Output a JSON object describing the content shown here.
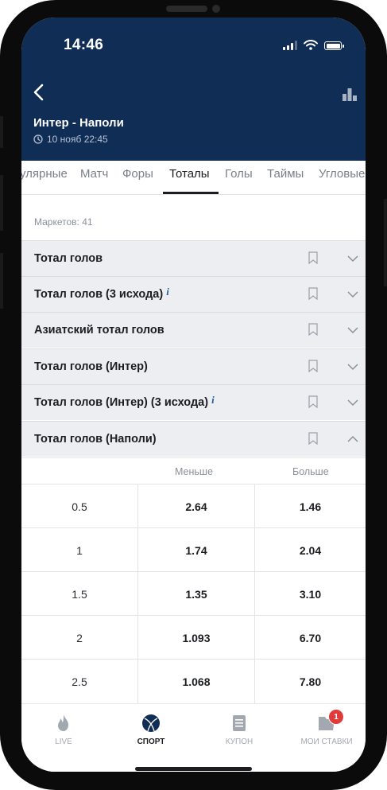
{
  "status_bar": {
    "time": "14:46"
  },
  "match": {
    "title": "Интер - Наполи",
    "date": "10 нояб 22:45"
  },
  "tabs": [
    {
      "label": "улярные"
    },
    {
      "label": "Матч"
    },
    {
      "label": "Форы"
    },
    {
      "label": "Тоталы",
      "active": true
    },
    {
      "label": "Голы"
    },
    {
      "label": "Таймы"
    },
    {
      "label": "Угловые"
    }
  ],
  "markets_count": "Маркетов: 41",
  "markets": [
    {
      "name": "Тотал голов",
      "info": ""
    },
    {
      "name": "Тотал голов (3 исхода)",
      "info": "i"
    },
    {
      "name": "Азиатский тотал голов",
      "info": ""
    },
    {
      "name": "Тотал голов (Интер)",
      "info": ""
    },
    {
      "name": "Тотал голов (Интер) (3 исхода)",
      "info": "i"
    },
    {
      "name": "Тотал голов (Наполи)",
      "info": "",
      "expanded": true
    }
  ],
  "odds_headers": {
    "under": "Меньше",
    "over": "Больше"
  },
  "odds_rows": [
    {
      "total": "0.5",
      "under": "2.64",
      "over": "1.46"
    },
    {
      "total": "1",
      "under": "1.74",
      "over": "2.04"
    },
    {
      "total": "1.5",
      "under": "1.35",
      "over": "3.10"
    },
    {
      "total": "2",
      "under": "1.093",
      "over": "6.70"
    },
    {
      "total": "2.5",
      "under": "1.068",
      "over": "7.80"
    }
  ],
  "bottom_nav": {
    "live": "LIVE",
    "sport": "СПОРТ",
    "coupon": "КУПОН",
    "my_bets": "МОИ СТАВКИ",
    "my_bets_badge": "1"
  },
  "colors": {
    "header_bg": "#0f2d55",
    "badge": "#e03a3a",
    "info": "#1f5fa8"
  }
}
